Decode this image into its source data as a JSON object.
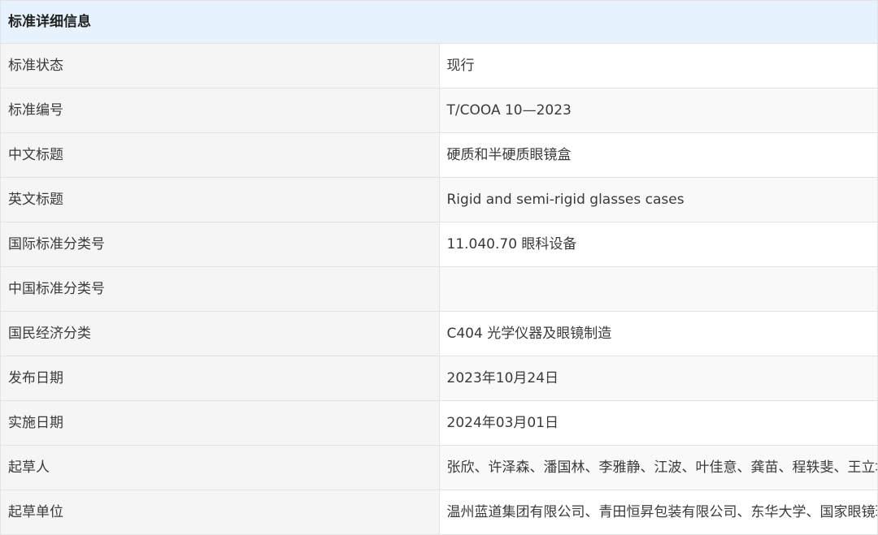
{
  "title": "标准详细信息",
  "rows": [
    {
      "label": "标准状态",
      "value": "现行"
    },
    {
      "label": "标准编号",
      "value": "T/COOA 10—2023"
    },
    {
      "label": "中文标题",
      "value": "硬质和半硬质眼镜盒"
    },
    {
      "label": "英文标题",
      "value": "Rigid and semi-rigid glasses cases"
    },
    {
      "label": "国际标准分类号",
      "value": "11.040.70 眼科设备"
    },
    {
      "label": "中国标准分类号",
      "value": ""
    },
    {
      "label": "国民经济分类",
      "value": "C404 光学仪器及眼镜制造"
    },
    {
      "label": "发布日期",
      "value": "2023年10月24日"
    },
    {
      "label": "实施日期",
      "value": "2024年03月01日"
    },
    {
      "label": "起草人",
      "value": "张欣、许泽森、潘国林、李雅静、江波、叶佳意、龚苗、程轶斐、王立坤、任鹏帅、薛剑赟、王连军、张尼尼"
    },
    {
      "label": "起草单位",
      "value": "温州蓝道集团有限公司、青田恒昇包装有限公司、东华大学、国家眼镜玻璃搪瓷制品质量检验检测中心"
    }
  ],
  "colors": {
    "header_background": "#e6f2fd",
    "label_background": "#f5f5f5",
    "border": "#e3e3e3",
    "text": "#333333"
  }
}
